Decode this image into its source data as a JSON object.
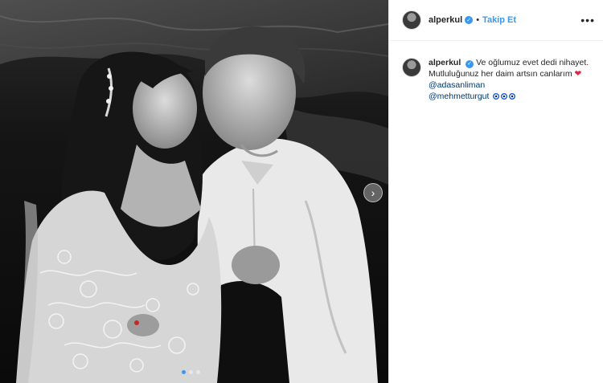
{
  "post": {
    "username": "alperkul",
    "follow_label": "Takip Et",
    "separator": "•",
    "more_label": "•••",
    "verified_glyph": "✓",
    "caption": {
      "username": "alperkul",
      "text_line": "Ve oğlumuz evet dedi nihayet. Mutluluğunuz her daim artsın canlarım",
      "heart": "❤",
      "mention1": "@adasanliman",
      "mention2": "@mehmetturgut"
    },
    "photo": {
      "next_glyph": "›",
      "slides_total": 3,
      "active_slide": 1
    }
  },
  "colors": {
    "accent": "#3897f0",
    "heart": "#e02640",
    "mention": "#00376b"
  },
  "icons": [
    "verified-badge-icon",
    "more-options-icon",
    "heart-icon",
    "evil-eye-emoji-icon",
    "next-arrow-icon"
  ]
}
